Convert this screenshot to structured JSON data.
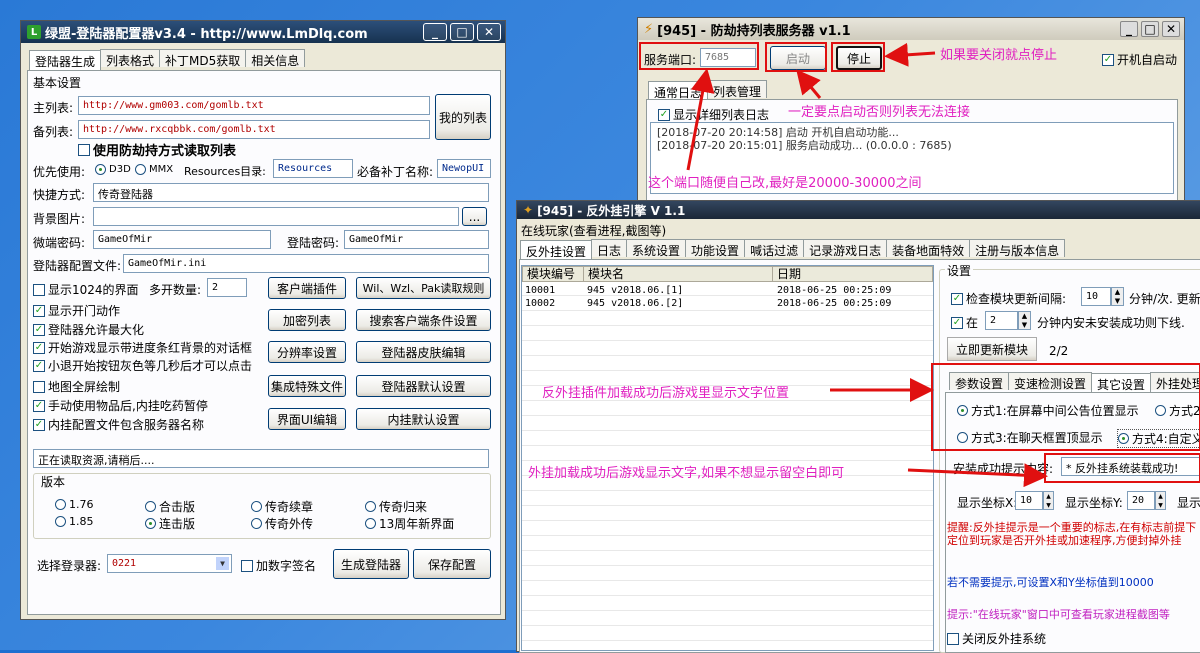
{
  "left_window": {
    "title": "绿盟-登陆器配置器v3.4 - http://www.LmDlq.com",
    "logo": "L",
    "tabs": [
      "登陆器生成",
      "列表格式",
      "补丁MD5获取",
      "相关信息"
    ],
    "basic_settings": "基本设置",
    "main_list_label": "主列表:",
    "main_list_value": "http://www.gm003.com/gomlb.txt",
    "backup_list_label": "备列表:",
    "backup_list_value": "http://www.rxcqbbk.com/gomlb.txt",
    "my_list_button": "我的列表",
    "use_hijack_list": "使用防劫持方式读取列表",
    "priority_label": "优先使用:",
    "d3d_label": "D3D",
    "mmx_label": "MMX",
    "resources_label": "Resources目录:",
    "resources_value": "Resources",
    "patch_label": "必备补丁名称:",
    "patch_value": "NewopUI",
    "shortcut_label": "快捷方式:",
    "shortcut_value": "传奇登陆器",
    "bg_image_label": "背景图片:",
    "bg_browse_button": "...",
    "client_pwd_label": "微端密码:",
    "client_pwd_value": "GameOfMir",
    "login_pwd_label": "登陆密码:",
    "login_pwd_value": "GameOfMir",
    "config_file_label": "登陆器配置文件:",
    "config_file_value": "GameOfMir.ini",
    "checkboxes": [
      {
        "label": "显示1024的界面",
        "checked": false
      },
      {
        "label": "显示开门动作",
        "checked": true
      },
      {
        "label": "登陆器允许最大化",
        "checked": true
      },
      {
        "label": "开始游戏显示带进度条红背景的对话框",
        "checked": true
      },
      {
        "label": "小退开始按钮灰色等几秒后才可以点击",
        "checked": true
      },
      {
        "label": "地图全屏绘制",
        "checked": false
      },
      {
        "label": "手动使用物品后,内挂吃药暂停",
        "checked": true
      },
      {
        "label": "内挂配置文件包含服务器名称",
        "checked": true
      }
    ],
    "multi_open_label": "多开数量:",
    "multi_open_value": "2",
    "buttons_col1": [
      "客户端插件",
      "加密列表",
      "分辨率设置",
      "集成特殊文件",
      "界面UI编辑"
    ],
    "buttons_col2": [
      "Wil、Wzl、Pak读取规则",
      "搜索客户端条件设置",
      "登陆器皮肤编辑",
      "登陆器默认设置",
      "内挂默认设置"
    ],
    "status_text": "正在读取资源,请稍后....",
    "version_group": "版本",
    "versions": [
      {
        "label": "1.76",
        "selected": false
      },
      {
        "label": "合击版",
        "selected": false
      },
      {
        "label": "传奇续章",
        "selected": false
      },
      {
        "label": "传奇归来",
        "selected": false
      },
      {
        "label": "1.85",
        "selected": false
      },
      {
        "label": "连击版",
        "selected": true
      },
      {
        "label": "传奇外传",
        "selected": false
      },
      {
        "label": "13周年新界面",
        "selected": false
      }
    ],
    "select_login_label": "选择登录器:",
    "select_login_value": "0221",
    "add_sign_label": "加数字签名",
    "generate_button": "生成登陆器",
    "save_button": "保存配置"
  },
  "server_window": {
    "title": "[945] - 防劫持列表服务器 v1.1",
    "port_label": "服务端口:",
    "port_value": "7685",
    "start_button": "启动",
    "stop_button": "停止",
    "autostart_label": "开机自启动",
    "tabs": [
      "通常日志",
      "列表管理"
    ],
    "show_log_label": "显示详细列表日志",
    "log_lines": [
      "[2018-07-20 20:14:58] 启动 开机自启动功能...",
      "[2018-07-20 20:15:01] 服务启动成功... (0.0.0.0 : 7685)"
    ]
  },
  "anticheat_window": {
    "title": "[945] - 反外挂引擎 V 1.1",
    "menu": "在线玩家(查看进程,截图等)",
    "tabs": [
      "反外挂设置",
      "日志",
      "系统设置",
      "功能设置",
      "喊话过滤",
      "记录游戏日志",
      "装备地面特效",
      "注册与版本信息"
    ],
    "columns": [
      "模块编号",
      "模块名",
      "日期"
    ],
    "rows": [
      [
        "10001",
        "945 v2018.06.[1]",
        "2018-06-25 00:25:09"
      ],
      [
        "10002",
        "945 v2018.06.[2]",
        "2018-06-25 00:25:09"
      ]
    ],
    "settings_group": "设置",
    "check_update_label": "检查模块更新间隔:",
    "check_update_value": "10",
    "check_update_unit": "分钟/次. 更新",
    "within_label": "在",
    "within_value": "2",
    "within_unit": "分钟内安未安装成功则下线.",
    "update_now_button": "立即更新模块",
    "page_indicator": "2/2",
    "sub_tabs": [
      "参数设置",
      "变速检测设置",
      "其它设置",
      "外挂处理"
    ],
    "mode1": "方式1:在屏幕中间公告位置显示",
    "mode2": "方式2",
    "mode3": "方式3:在聊天框置顶显示",
    "mode4": "方式4:自定义",
    "success_label": "安装成功提示内容:",
    "success_value": "* 反外挂系统装载成功!",
    "x_label": "显示坐标X:",
    "x_value": "10",
    "y_label": "显示坐标Y:",
    "y_value": "20",
    "extra_label": "显示",
    "note_red": "提醒:反外挂提示是一个重要的标志,在有标志前提下定位到玩家是否开外挂或加速程序,方便封掉外挂",
    "note_blue": "若不需要提示,可设置X和Y坐标值到10000",
    "note_pink": "提示:\"在线玩家\"窗口中可查看玩家进程截图等",
    "close_anticheat_label": "关闭反外挂系统"
  },
  "annotations": {
    "stop_hint": "如果要关闭就点停止",
    "start_hint": "一定要点启动否则列表无法连接",
    "port_hint": "这个端口随便自己改,最好是20000-30000之间",
    "position_hint": "反外挂插件加载成功后游戏里显示文字位置",
    "text_hint": "外挂加载成功后游戏显示文字,如果不想显示留空白即可"
  },
  "colors": {
    "desktop": "#3b87de",
    "annotation": "#e020c0",
    "arrow": "#e01010"
  }
}
